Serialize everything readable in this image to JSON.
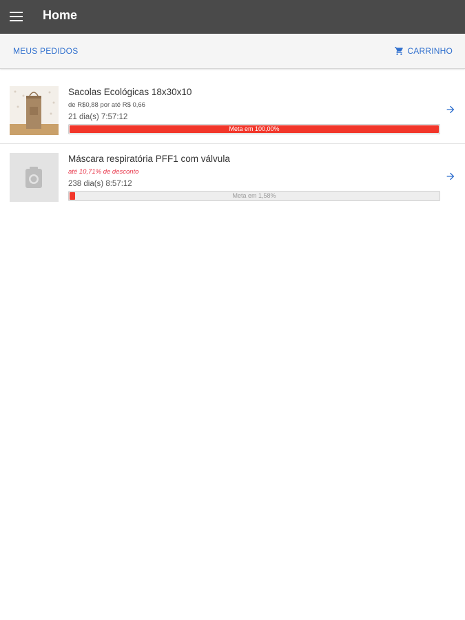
{
  "appbar": {
    "title": "Home",
    "background": "#4a4a4a"
  },
  "actions": {
    "orders_label": "MEUS PEDIDOS",
    "cart_label": "CARRINHO",
    "accent": "#2f6fce"
  },
  "items": [
    {
      "title": "Sacolas Ecológicas 18x30x10",
      "subtitle": "de R$0,88 por até R$ 0,66",
      "subtitle_style": "normal",
      "time_left": "21 dia(s) 7:57:12",
      "progress_label": "Meta em 100,00%",
      "progress_percent": 100,
      "thumbnail": "bag-photo",
      "arrow_icon": "arrow-right-icon"
    },
    {
      "title": "Máscara respiratória PFF1 com válvula",
      "subtitle": "até 10,71% de desconto",
      "subtitle_style": "discount",
      "time_left": "238 dia(s) 8:57:12",
      "progress_label": "Meta em 1,58%",
      "progress_percent": 1.58,
      "thumbnail": "camera-placeholder-icon",
      "arrow_icon": "arrow-right-icon"
    }
  ],
  "colors": {
    "progress_fill": "#f2362a",
    "discount_text": "#e8364a"
  }
}
